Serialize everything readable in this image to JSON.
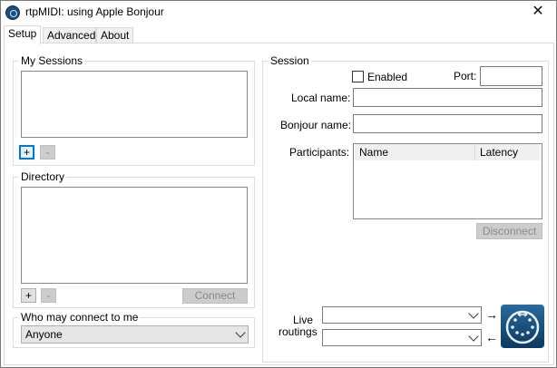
{
  "window": {
    "title": "rtpMIDI: using Apple Bonjour",
    "close_glyph": "✕"
  },
  "icons": {
    "app": "rtpmidi-app-icon",
    "logo": "midi-din-logo"
  },
  "tabs": [
    {
      "label": "Setup",
      "active": true
    },
    {
      "label": "Advanced",
      "active": false
    },
    {
      "label": "About",
      "active": false
    }
  ],
  "my_sessions": {
    "title": "My Sessions",
    "add_label": "+",
    "remove_label": "-"
  },
  "directory": {
    "title": "Directory",
    "add_label": "+",
    "remove_label": "-",
    "connect_label": "Connect"
  },
  "who_may_connect": {
    "title": "Who may connect to me",
    "selected": "Anyone"
  },
  "session": {
    "title": "Session",
    "enabled_label": "Enabled",
    "port_label": "Port:",
    "port_value": "",
    "local_name_label": "Local name:",
    "local_name_value": "",
    "bonjour_name_label": "Bonjour name:",
    "bonjour_name_value": "",
    "participants_label": "Participants:",
    "columns": [
      "Name",
      "Latency"
    ],
    "disconnect_label": "Disconnect"
  },
  "live_routings": {
    "label_line1": "Live",
    "label_line2": "routings",
    "arrow_out": "→",
    "arrow_in": "←"
  }
}
